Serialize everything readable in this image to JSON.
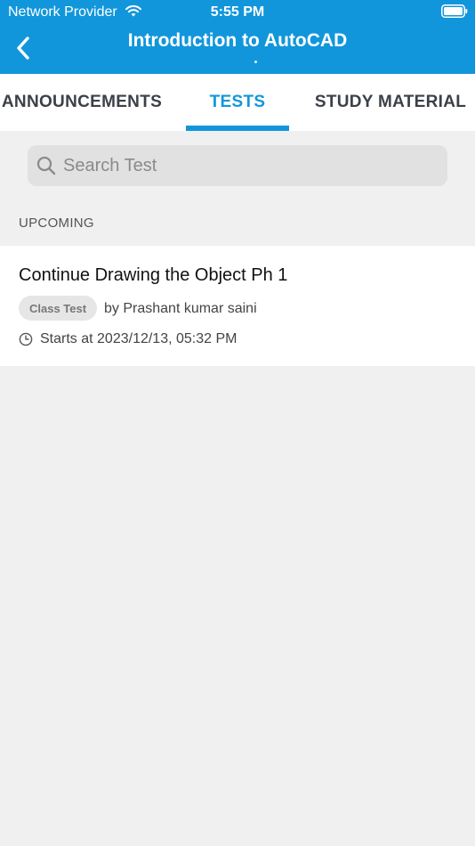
{
  "status_bar": {
    "carrier": "Network Provider",
    "time": "5:55 PM"
  },
  "header": {
    "title": "Introduction to AutoCAD",
    "background_color": "#1296db"
  },
  "tabs": [
    {
      "label": "ANNOUNCEMENTS",
      "active": false
    },
    {
      "label": "TESTS",
      "active": true
    },
    {
      "label": "STUDY MATERIAL",
      "active": false
    }
  ],
  "search": {
    "placeholder": "Search Test",
    "value": ""
  },
  "section": {
    "label": "UPCOMING"
  },
  "tests": [
    {
      "title": "Continue Drawing the Object Ph 1",
      "badge": "Class Test",
      "author": "by Prashant kumar saini",
      "starts": "Starts at 2023/12/13, 05:32 PM"
    }
  ],
  "icons": {
    "back": "chevron-left-icon",
    "search": "search-icon",
    "clock": "clock-icon",
    "wifi": "wifi-icon",
    "battery": "battery-icon"
  },
  "colors": {
    "accent": "#1296db",
    "page_background": "#f0f0f0"
  }
}
